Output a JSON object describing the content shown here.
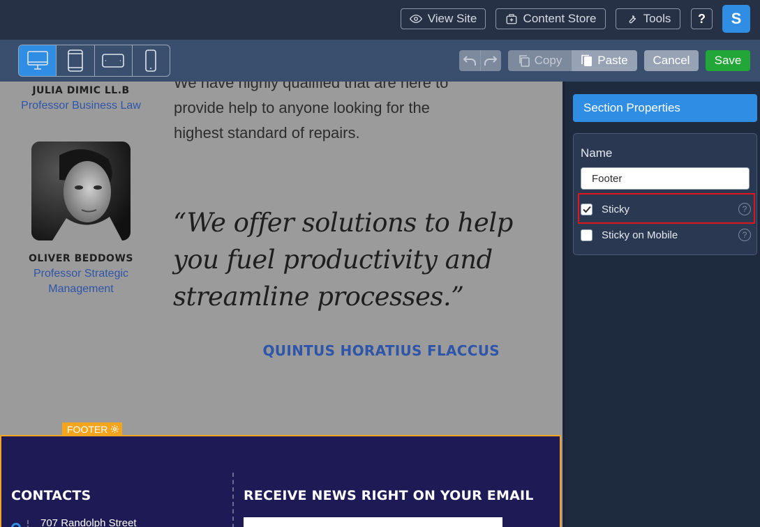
{
  "topbar": {
    "view_site": "View Site",
    "content_store": "Content Store",
    "tools": "Tools",
    "help": "?",
    "avatar_letter": "S"
  },
  "toolbar": {
    "devices": [
      "desktop-icon",
      "tablet-icon",
      "tablet-landscape-icon",
      "mobile-icon"
    ],
    "active_device": "desktop",
    "copy_label": "Copy",
    "paste_label": "Paste",
    "cancel_label": "Cancel",
    "save_label": "Save"
  },
  "canvas": {
    "people": [
      {
        "name": "JULIA DIMIC LL.B",
        "role": "Professor Business Law"
      },
      {
        "name": "OLIVER BEDDOWS",
        "role": "Professor Strategic Management"
      }
    ],
    "body_text": "We have highly qualified that are here to provide help to anyone looking for the highest standard of repairs.",
    "quote": "“We offer solutions to help you fuel productivity and streamline processes.”",
    "author": "QUINTUS HORATIUS FLACCUS",
    "footer_tag": "FOOTER",
    "footer": {
      "contacts_heading": "CONTACTS",
      "news_heading": "RECEIVE NEWS RIGHT ON YOUR EMAIL",
      "address": "707 Randolph Street"
    }
  },
  "panel": {
    "header": "Section Properties",
    "name_label": "Name",
    "name_value": "Footer",
    "options": [
      {
        "label": "Sticky",
        "checked": true
      },
      {
        "label": "Sticky on Mobile",
        "checked": false
      }
    ]
  },
  "colors": {
    "accent": "#2f8de4",
    "save": "#21a637",
    "footer_border": "#f4a51d",
    "highlight": "#e0151c"
  }
}
